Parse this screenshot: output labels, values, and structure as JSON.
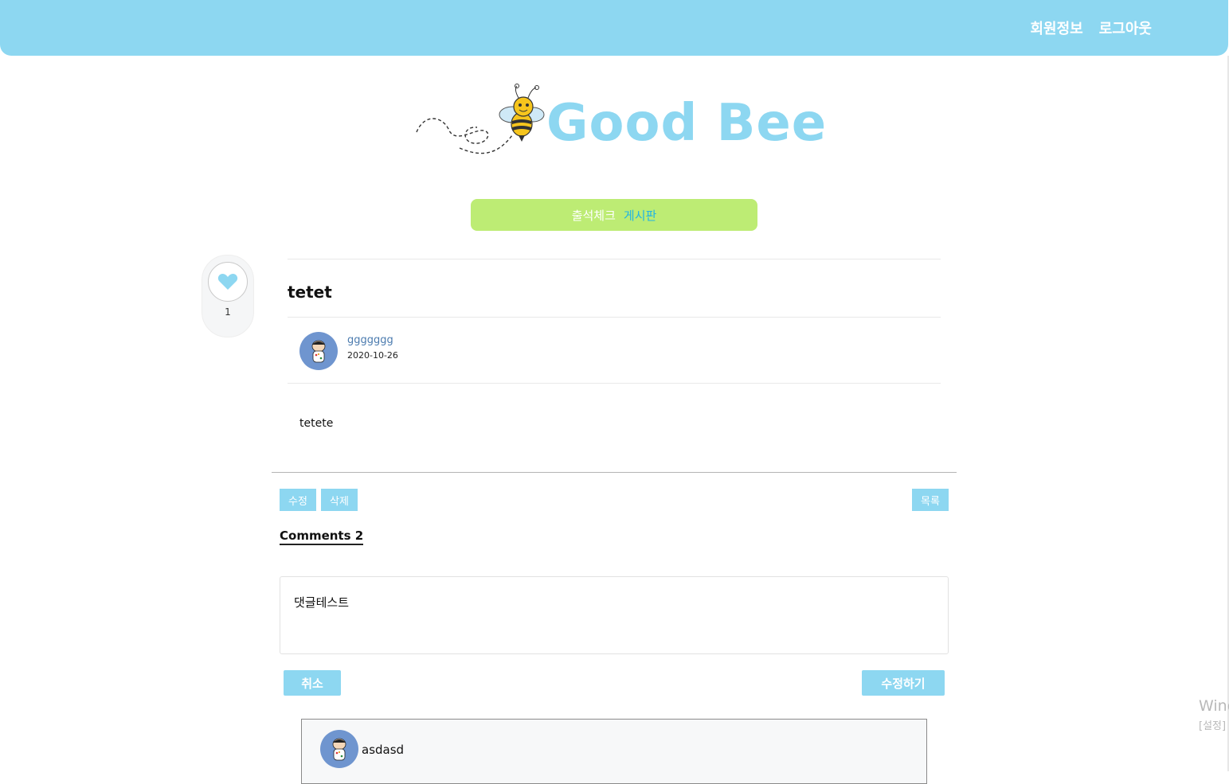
{
  "header": {
    "nav": [
      "회원정보",
      "로그아웃"
    ],
    "bg_color": "#8dd7f1"
  },
  "logo": {
    "text": "Good Bee",
    "color": "#8dd7f1"
  },
  "menu": {
    "items": [
      "출석체크",
      "게시판"
    ],
    "bg_color": "#bdec74",
    "active_color": "#21b4e4"
  },
  "like": {
    "count": "1",
    "heart_color": "#8dd7f1"
  },
  "post": {
    "title": "tetet",
    "author": "ggggggg",
    "date": "2020-10-26",
    "body": "tetete"
  },
  "actions": {
    "edit": "수정",
    "delete": "삭제",
    "list": "목록"
  },
  "comments": {
    "label": "Comments 2",
    "edit_text": "댓글테스트",
    "cancel": "취소",
    "submit": "수정하기",
    "items": [
      {
        "author": "asdasd"
      }
    ]
  },
  "watermark": {
    "line1": "Wind",
    "line2": "[설정]"
  }
}
